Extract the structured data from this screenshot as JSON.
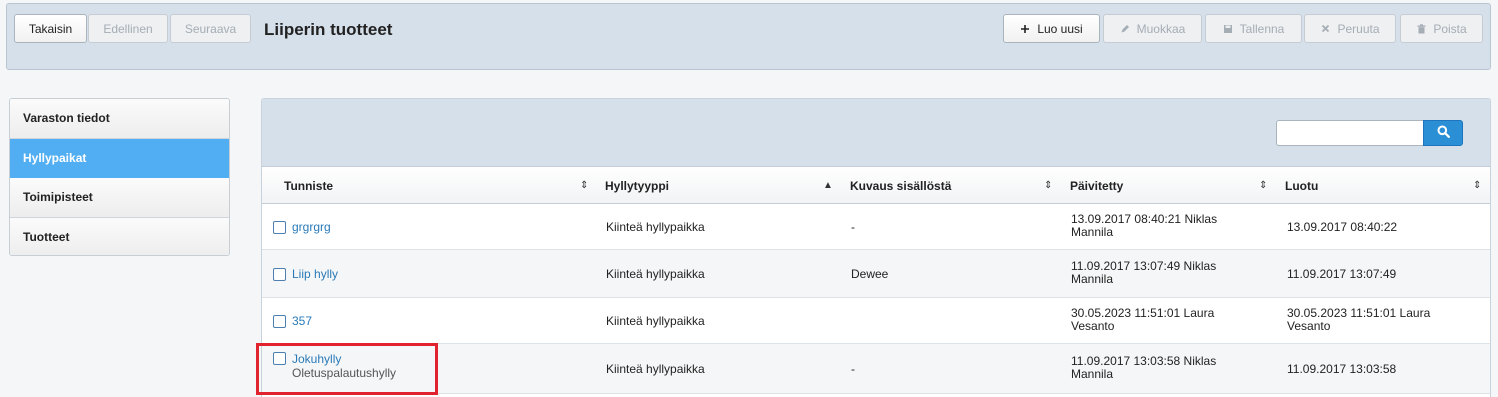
{
  "toolbar": {
    "back_label": "Takaisin",
    "prev_label": "Edellinen",
    "next_label": "Seuraava",
    "title": "Liiperin tuotteet",
    "new_label": "Luo uusi",
    "edit_label": "Muokkaa",
    "save_label": "Tallenna",
    "cancel_label": "Peruuta",
    "delete_label": "Poista"
  },
  "sidebar": {
    "items": [
      {
        "label": "Varaston tiedot"
      },
      {
        "label": "Hyllypaikat"
      },
      {
        "label": "Toimipisteet"
      },
      {
        "label": "Tuotteet"
      }
    ]
  },
  "search": {
    "value": "",
    "placeholder": ""
  },
  "table": {
    "columns": [
      "Tunniste",
      "Hyllytyyppi",
      "Kuvaus sisällöstä",
      "Päivitetty",
      "Luotu"
    ],
    "rows": [
      {
        "id": "grgrgrg",
        "sub": "",
        "type": "Kiinteä hyllypaikka",
        "desc": "-",
        "updated_1": "13.09.2017 08:40:21 Niklas",
        "updated_2": "Mannila",
        "created_1": "13.09.2017 08:40:22",
        "created_2": ""
      },
      {
        "id": "Liip hylly",
        "sub": "",
        "type": "Kiinteä hyllypaikka",
        "desc": "Dewee",
        "updated_1": "11.09.2017 13:07:49 Niklas",
        "updated_2": "Mannila",
        "created_1": "11.09.2017 13:07:49",
        "created_2": ""
      },
      {
        "id": "357",
        "sub": "",
        "type": "Kiinteä hyllypaikka",
        "desc": "",
        "updated_1": "30.05.2023 11:51:01 Laura",
        "updated_2": "Vesanto",
        "created_1": "30.05.2023 11:51:01 Laura",
        "created_2": "Vesanto"
      },
      {
        "id": "Jokuhylly",
        "sub": "Oletuspalautushylly",
        "type": "Kiinteä hyllypaikka",
        "desc": "-",
        "updated_1": "11.09.2017 13:03:58 Niklas",
        "updated_2": "Mannila",
        "created_1": "11.09.2017 13:03:58",
        "created_2": ""
      }
    ]
  },
  "colors": {
    "header_bg": "#d6e0ea",
    "active_sidebar": "#52aef2",
    "link": "#2a7ab8",
    "highlight": "#e0232e"
  }
}
